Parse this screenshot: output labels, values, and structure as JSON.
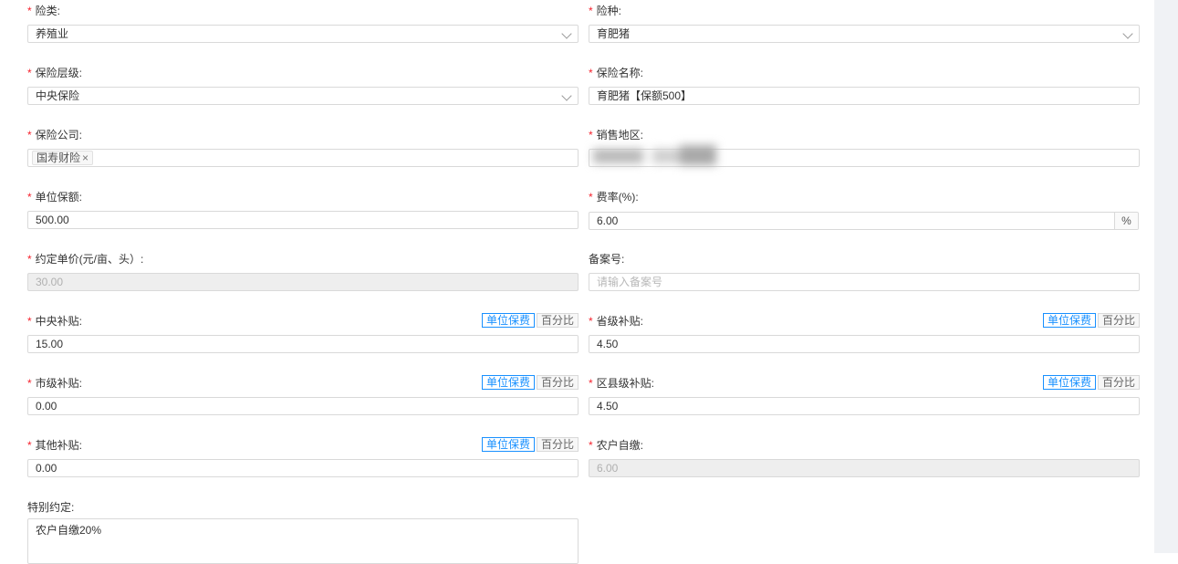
{
  "form": {
    "insurance_class": {
      "label": "险类:",
      "value": "养殖业"
    },
    "insurance_type": {
      "label": "险种:",
      "value": "育肥猪"
    },
    "insurance_level": {
      "label": "保险层级:",
      "value": "中央保险"
    },
    "insurance_name": {
      "label": "保险名称:",
      "value": "育肥猪【保额500】"
    },
    "insurance_company": {
      "label": "保险公司:",
      "tags": [
        "国寿财险"
      ],
      "remove_glyph": "×"
    },
    "sales_region": {
      "label": "销售地区:"
    },
    "unit_coverage": {
      "label": "单位保额:",
      "value": "500.00"
    },
    "rate": {
      "label": "费率(%):",
      "value": "6.00",
      "suffix": "%"
    },
    "unit_price": {
      "label": "约定单价(元/亩、头）:",
      "value": "30.00"
    },
    "record_no": {
      "label": "备案号:",
      "placeholder": "请输入备案号"
    },
    "central_subsidy": {
      "label": "中央补贴:",
      "value": "15.00"
    },
    "provincial_subsidy": {
      "label": "省级补贴:",
      "value": "4.50"
    },
    "city_subsidy": {
      "label": "市级补贴:",
      "value": "0.00"
    },
    "county_subsidy": {
      "label": "区县级补贴:",
      "value": "4.50"
    },
    "other_subsidy": {
      "label": "其他补贴:",
      "value": "0.00"
    },
    "farmer_payment": {
      "label": "农户自缴:",
      "value": "6.00"
    },
    "special_agreement": {
      "label": "特别约定:",
      "value": "农户自缴20%"
    }
  },
  "toggle": {
    "unit": "单位保费",
    "percent": "百分比"
  },
  "required_mark": "*",
  "colors": {
    "required": "#f5222d",
    "accent": "#1890ff",
    "border": "#d9d9d9",
    "disabled_bg": "#eeeeee"
  }
}
